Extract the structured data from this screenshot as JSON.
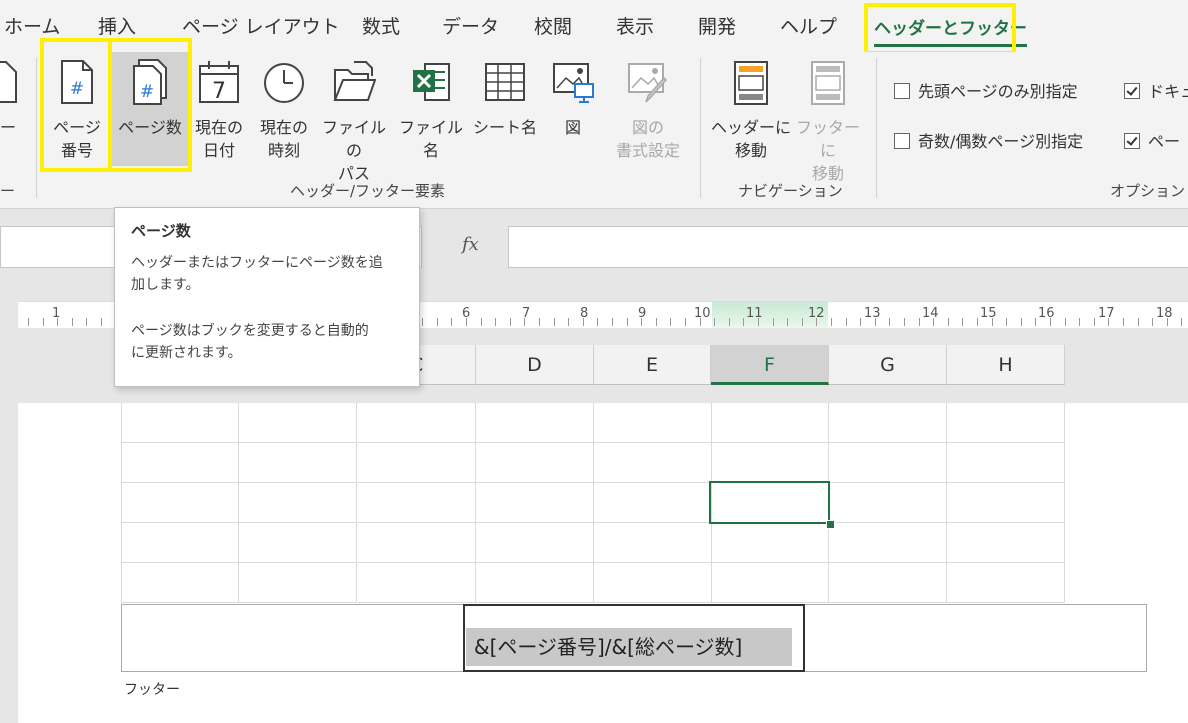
{
  "tabs": [
    "ホーム",
    "挿入",
    "ページ レイアウト",
    "数式",
    "データ",
    "校閲",
    "表示",
    "開発",
    "ヘルプ",
    "ヘッダーとフッター"
  ],
  "ribbon": {
    "left_partial_label": "ー",
    "buttons": {
      "page_number": "ページ\n番号",
      "page_count": "ページ数",
      "current_date": "現在の\n日付",
      "current_time": "現在の\n時刻",
      "file_path": "ファイルの\nパス",
      "file_name": "ファイル名",
      "sheet_name": "シート名",
      "picture": "図",
      "format_picture": "図の\n書式設定",
      "go_to_header": "ヘッダーに\n移動",
      "go_to_footer": "フッターに\n移動"
    },
    "groups": {
      "left_partial": "ー",
      "elements": "ヘッダー/フッター要素",
      "navigation": "ナビゲーション",
      "options": "オプション"
    },
    "options": {
      "first_page_diff": "先頭ページのみ別指定",
      "odd_even_diff": "奇数/偶数ページ別指定",
      "scale_with_doc": "ドキュ",
      "align_margins": "ペー"
    },
    "icon_texts": {
      "hash": "#",
      "seven": "7"
    }
  },
  "formula_bar": {
    "fx_label": "fx"
  },
  "tooltip": {
    "title": "ページ数",
    "para1": "ヘッダーまたはフッターにページ数を追\n加します。",
    "para2": "ページ数はブックを変更すると自動的\nに更新されます。"
  },
  "ruler": {
    "numbers": [
      "1",
      "6",
      "7",
      "8",
      "9",
      "10",
      "11",
      "12",
      "13",
      "14",
      "15",
      "16",
      "17",
      "18"
    ]
  },
  "columns": [
    "C",
    "D",
    "E",
    "F",
    "G",
    "H"
  ],
  "footer": {
    "content": "&[ページ番号]/&[総ページ数]",
    "label": "フッター"
  },
  "colors": {
    "accent": "#217346",
    "highlight": "#ffef00"
  }
}
